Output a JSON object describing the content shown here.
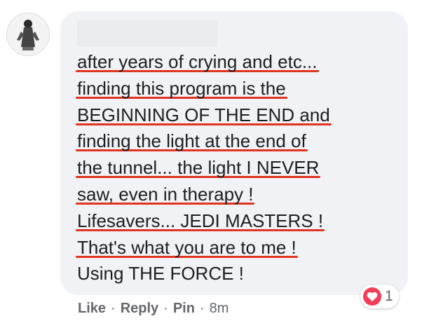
{
  "comment": {
    "author_redacted": true,
    "lines": [
      {
        "text": "after years of crying and etc...",
        "underlined": true
      },
      {
        "text": "finding this program is the",
        "underlined": true
      },
      {
        "text": "BEGINNING OF THE END and",
        "underlined": true
      },
      {
        "text": "finding the light at the end of",
        "underlined": true
      },
      {
        "text": "the tunnel... the light I NEVER",
        "underlined": true
      },
      {
        "text": "saw, even in therapy !",
        "underlined": true
      },
      {
        "text": "Lifesavers... JEDI MASTERS !",
        "underlined": true
      },
      {
        "text": "That's what you are to me !",
        "underlined": true
      },
      {
        "text": "Using THE FORCE !",
        "underlined": false
      }
    ]
  },
  "reactions": {
    "icon": "heart-icon",
    "count": "1",
    "color": "#f33e58"
  },
  "actions": {
    "like_label": "Like",
    "reply_label": "Reply",
    "pin_label": "Pin",
    "separator": "·",
    "timestamp": "8m"
  },
  "colors": {
    "bubble": "#f0f2f5",
    "text": "#1c1e21",
    "meta": "#65676b",
    "underline": "#e0341f"
  }
}
